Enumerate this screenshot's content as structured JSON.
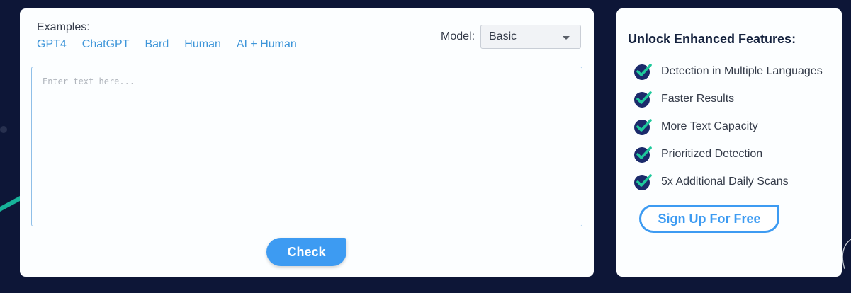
{
  "examples": {
    "label": "Examples:",
    "links": [
      "GPT4",
      "ChatGPT",
      "Bard",
      "Human",
      "AI + Human"
    ]
  },
  "model": {
    "label": "Model:",
    "selected": "Basic"
  },
  "input": {
    "placeholder": "Enter text here...",
    "value": ""
  },
  "check_button": {
    "label": "Check"
  },
  "features": {
    "title": "Unlock Enhanced Features:",
    "icon": "checkmark-badge-icon",
    "items": [
      "Detection in Multiple Languages",
      "Faster Results",
      "More Text Capacity",
      "Prioritized Detection",
      "5x Additional Daily Scans"
    ]
  },
  "signup_button": {
    "label": "Sign Up For Free"
  },
  "colors": {
    "background": "#0d1637",
    "card": "#fcfeff",
    "link": "#3d95d9",
    "accent_blue": "#3d9bf2",
    "icon_navy": "#1b2a6b",
    "icon_check": "#1ec99b",
    "deco_teal": "#17b39a"
  }
}
